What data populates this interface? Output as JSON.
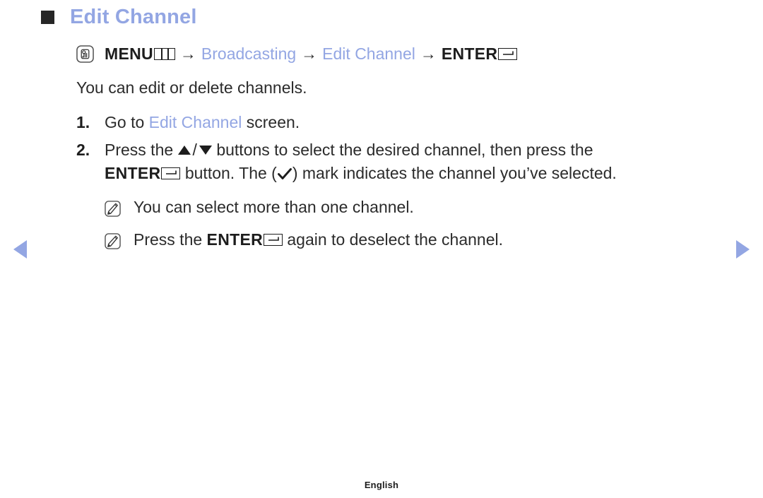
{
  "page": {
    "title": "Edit Channel",
    "bullet_icon": "filled-square-bullet",
    "footer_language": "English"
  },
  "nav_path": {
    "hand_icon": "hand-press-button-icon",
    "menu_label": "MENU",
    "menu_glyph_icon": "menu-three-column-icon",
    "arrow_1": "→",
    "item_broadcasting": "Broadcasting",
    "arrow_2": "→",
    "item_edit_channel": "Edit Channel",
    "arrow_3": "→",
    "enter_label": "ENTER",
    "enter_glyph_icon": "enter-return-arrow-icon"
  },
  "intro": "You can edit or delete channels.",
  "steps": [
    {
      "number": "1.",
      "prefix": "Go to ",
      "highlight": "Edit Channel",
      "suffix": " screen."
    },
    {
      "number": "2.",
      "line1_a": "Press the ",
      "up_icon": "triangle-up-icon",
      "slash": "/",
      "down_icon": "triangle-down-icon",
      "line1_b": " buttons to select the desired channel, then press the",
      "line2_a": "ENTER",
      "enter_glyph_icon": "enter-return-arrow-icon",
      "line2_b": " button. The (",
      "check_icon": "checkmark-icon",
      "line2_c": ") mark indicates the channel you’ve selected."
    }
  ],
  "notes": [
    {
      "icon": "note-pencil-icon",
      "text": "You can select more than one channel."
    },
    {
      "icon": "note-pencil-icon",
      "prefix": "Press the ",
      "bold": "ENTER",
      "enter_glyph_icon": "enter-return-arrow-icon",
      "suffix": " again to deselect the channel."
    }
  ],
  "page_nav": {
    "prev_icon": "previous-page-arrow-icon",
    "next_icon": "next-page-arrow-icon"
  },
  "colors": {
    "accent_blue": "#93a6e3",
    "text_dark": "#2b2b2b",
    "bullet": "#262626"
  }
}
